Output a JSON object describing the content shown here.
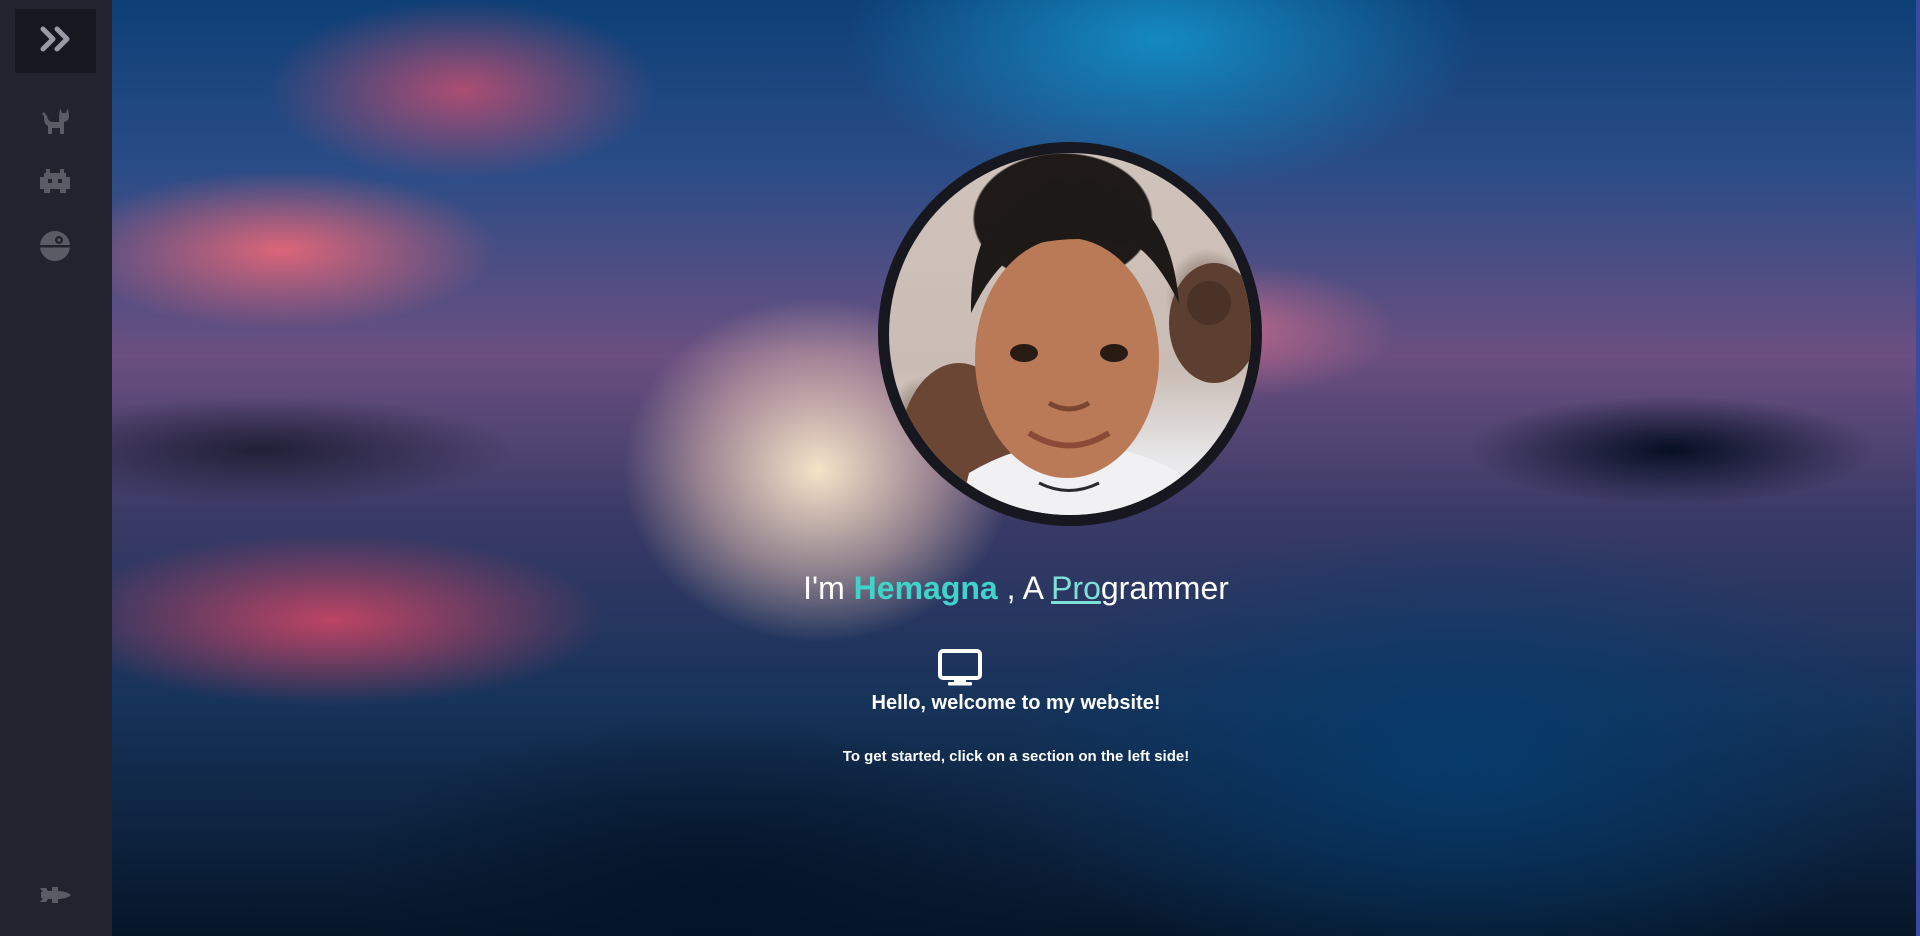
{
  "sidebar": {
    "toggle_icon": "double-chevron-right-icon",
    "items": [
      {
        "icon": "cat-icon"
      },
      {
        "icon": "space-invader-icon"
      },
      {
        "icon": "death-star-icon"
      }
    ],
    "bottom_icon": "space-shuttle-icon",
    "icon_color": "#5b5b66"
  },
  "hero": {
    "avatar_alt": "Profile photo",
    "intro_prefix": "I'm ",
    "name": "Hemagna",
    "intro_mid": " , A ",
    "typed_text": "Pro",
    "typed_rest": "grammer",
    "monitor_icon": "desktop-monitor-icon",
    "welcome": "Hello, welcome to my website!",
    "instruction": "To get started, click on a section on the left side!"
  },
  "colors": {
    "accent": "#3fd3c9",
    "sidebar_bg": "#23232f",
    "toggle_bg": "#17171f"
  }
}
